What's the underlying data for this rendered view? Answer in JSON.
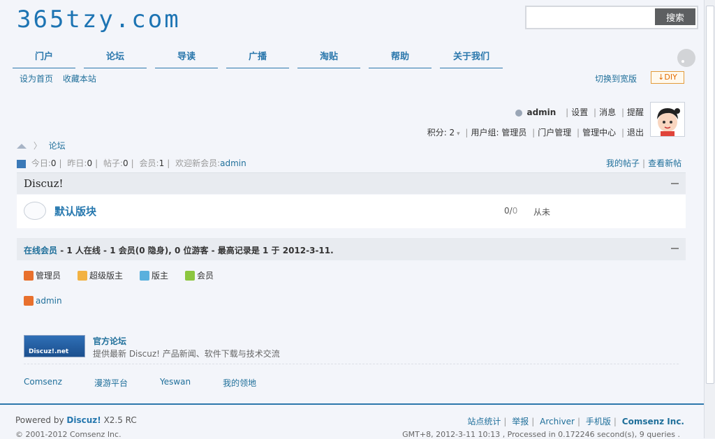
{
  "logo": "365tzy.com",
  "search": {
    "placeholder": "",
    "button": "搜索"
  },
  "nav": [
    "门户",
    "论坛",
    "导读",
    "广播",
    "淘贴",
    "帮助",
    "关于我们"
  ],
  "quick_links": [
    "设为首页",
    "收藏本站"
  ],
  "switch_wide": "切换到宽版",
  "diy": "↓DIY",
  "user": {
    "name": "admin",
    "row1": [
      "设置",
      "消息",
      "提醒"
    ],
    "points_label": "积分: 2",
    "row2": [
      "用户组: 管理员",
      "门户管理",
      "管理中心",
      "退出"
    ]
  },
  "breadcrumb": "论坛",
  "stats": {
    "today_label": "今日:",
    "today": "0",
    "yesterday_label": "昨日:",
    "yesterday": "0",
    "posts_label": "帖子:",
    "posts": "0",
    "members_label": "会员:",
    "members": "1",
    "welcome_label": "欢迎新会员:",
    "welcome_user": "admin"
  },
  "my_posts": "我的帖子",
  "new_posts": "查看新帖",
  "category": "Discuz!",
  "forum": {
    "name": "默认版块",
    "count": "0",
    "count2": "0",
    "last": "从未"
  },
  "online": {
    "label": "在线会员",
    "text": " - 1 人在线 - 1 会员(0 隐身), 0 位游客 - 最高记录是 1 于 2012-3-11.",
    "legend": [
      "管理员",
      "超级版主",
      "版主",
      "会员"
    ],
    "user": "admin"
  },
  "official": {
    "banner": "Discuz!.net",
    "title": "官方论坛",
    "desc": "提供最新 Discuz! 产品新闻、软件下载与技术交流"
  },
  "links": [
    "Comsenz",
    "漫游平台",
    "Yeswan",
    "我的领地"
  ],
  "footer": {
    "powered_prefix": "Powered by",
    "powered_brand": "Discuz!",
    "version": "X2.5 RC",
    "links": [
      "站点统计",
      "举报",
      "Archiver",
      "手机版",
      "Comsenz Inc."
    ],
    "copyright": "© 2001-2012 Comsenz Inc.",
    "gmt": "GMT+8, 2012-3-11 10:13 , Processed in 0.172246 second(s), 9 queries ."
  },
  "colors": {
    "accent": "#1f6f9a",
    "nav_blue": "#2a77ac",
    "diy_orange": "#e36b00"
  }
}
